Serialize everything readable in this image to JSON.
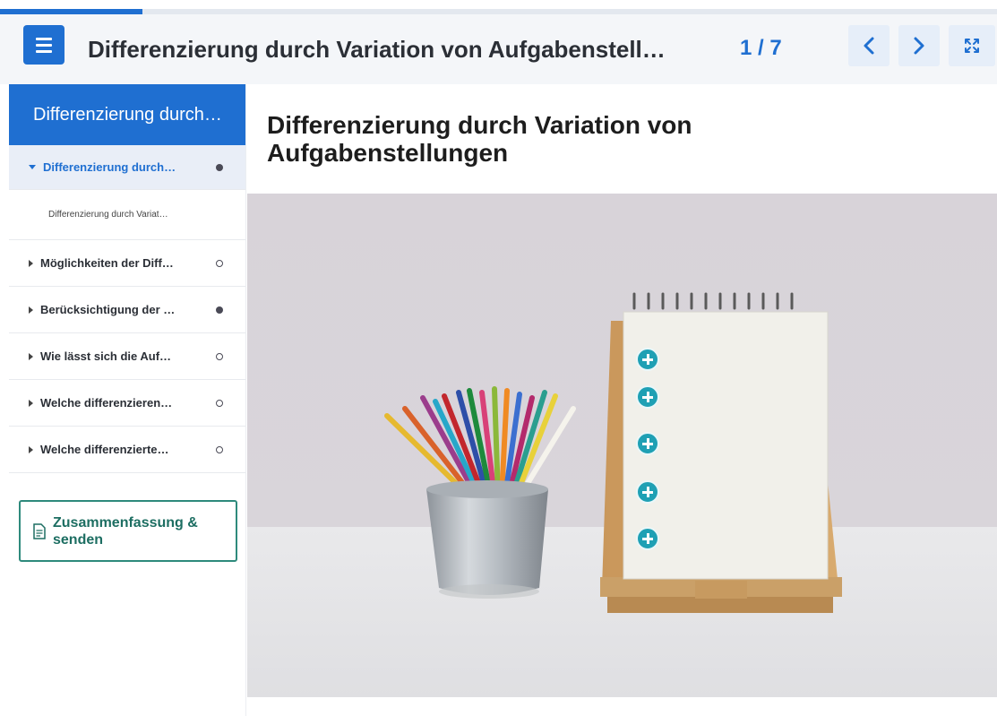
{
  "progress": {
    "current": 1,
    "total": 7
  },
  "header": {
    "title": "Differenzierung durch Variation von Aufgabenstell…",
    "page_counter": "1 / 7"
  },
  "sidebar": {
    "title": "Differenzierung durch…",
    "items": [
      {
        "label": "Differenzierung durch…",
        "status": "filled",
        "expanded": true
      },
      {
        "sub_label": "Differenzierung durch Variat…"
      },
      {
        "label": "Möglichkeiten der Diff…",
        "status": "empty"
      },
      {
        "label": "Berücksichtigung der …",
        "status": "filled"
      },
      {
        "label": "Wie lässt sich die Auf…",
        "status": "empty"
      },
      {
        "label": "Welche differenzieren…",
        "status": "empty"
      },
      {
        "label": "Welche differenzierte…",
        "status": "empty"
      }
    ],
    "summary_button": "Zusammenfassung & senden"
  },
  "main": {
    "title": "Differenzierung durch Variation von Aufgabenstellungen",
    "hotspot_count": 5
  },
  "colors": {
    "accent": "#1f6fd1",
    "summary": "#2e8a7c",
    "hotspot": "#1fa0b4"
  }
}
